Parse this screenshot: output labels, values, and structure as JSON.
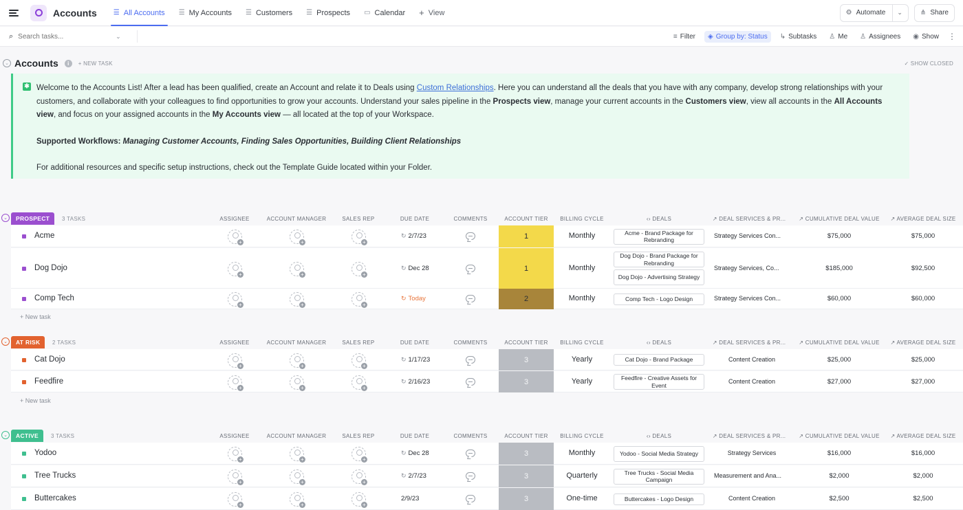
{
  "topbar": {
    "title": "Accounts",
    "tabs": [
      {
        "label": "All Accounts",
        "active": true
      },
      {
        "label": "My Accounts"
      },
      {
        "label": "Customers"
      },
      {
        "label": "Prospects"
      },
      {
        "label": "Calendar"
      },
      {
        "label": "View"
      }
    ],
    "automate": "Automate",
    "share": "Share"
  },
  "filterbar": {
    "search_placeholder": "Search tasks...",
    "filter": "Filter",
    "group_by": "Group by: Status",
    "subtasks": "Subtasks",
    "me": "Me",
    "assignees": "Assignees",
    "show": "Show"
  },
  "list": {
    "title": "Accounts",
    "new_task": "+ NEW TASK",
    "show_closed": "SHOW CLOSED"
  },
  "description": {
    "p1_a": "Welcome to the Accounts List! After a lead has been qualified, create an Account and relate it to Deals using ",
    "p1_link": "Custom Relationships",
    "p1_b": ". Here you can understand all the deals that you have with any company, develop strong relationships with your customers, and collaborate with your colleagues to find opportunities to grow your accounts. Understand your sales pipeline in the ",
    "p1_bold1": "Prospects view",
    "p1_c": ", manage your current accounts in the ",
    "p1_bold2": "Customers view",
    "p1_d": ", view all accounts in the ",
    "p1_bold3": "All Accounts view",
    "p1_e": ", and focus on your assigned accounts in the ",
    "p1_bold4": "My Accounts view",
    "p1_f": " — all located at the top of your Workspace.",
    "workflows_label": "Supported Workflows:",
    "workflows": " Managing Customer Accounts,  Finding Sales Opportunities, Building Client Relationships",
    "p3": "For additional resources and specific setup instructions, check out the Template Guide located within your Folder."
  },
  "columns": {
    "assignee": "ASSIGNEE",
    "account_manager": "ACCOUNT MANAGER",
    "sales_rep": "SALES REP",
    "due_date": "DUE DATE",
    "comments": "COMMENTS",
    "account_tier": "ACCOUNT TIER",
    "billing_cycle": "BILLING CYCLE",
    "deals": "DEALS",
    "deal_services": "DEAL SERVICES & PR...",
    "cumulative": "CUMULATIVE DEAL VALUE",
    "average": "AVERAGE DEAL SIZE"
  },
  "new_task_row": "+ New task",
  "colors": {
    "accent": "#4b6cf0",
    "prospect": "#9b4fcf",
    "at_risk": "#e2622f",
    "active": "#3fbf8f",
    "tier_yellow": "#f3d94a",
    "tier_brown": "#a8853a",
    "tier_gray": "#b9bcc2"
  },
  "groups": [
    {
      "status": "PROSPECT",
      "count": "3 TASKS",
      "tasks": [
        {
          "name": "Acme",
          "due": "2/7/23",
          "tier": "1",
          "billing": "Monthly",
          "deals": [
            "Acme - Brand Package for Rebranding"
          ],
          "services": "Strategy Services Con...",
          "cumulative": "$75,000",
          "average": "$75,000"
        },
        {
          "name": "Dog Dojo",
          "due": "Dec 28",
          "tier": "1",
          "billing": "Monthly",
          "deals": [
            "Dog Dojo - Brand Package for Rebranding",
            "Dog Dojo - Advertising Strategy"
          ],
          "services": "Strategy Services, Co...",
          "cumulative": "$185,000",
          "average": "$92,500"
        },
        {
          "name": "Comp Tech",
          "due": "Today",
          "tier": "2",
          "billing": "Monthly",
          "deals": [
            "Comp Tech - Logo Design"
          ],
          "services": "Strategy Services Con...",
          "cumulative": "$60,000",
          "average": "$60,000"
        }
      ]
    },
    {
      "status": "AT RISK",
      "count": "2 TASKS",
      "tasks": [
        {
          "name": "Cat Dojo",
          "due": "1/17/23",
          "tier": "3",
          "billing": "Yearly",
          "deals": [
            "Cat Dojo - Brand Package"
          ],
          "services": "Content Creation",
          "cumulative": "$25,000",
          "average": "$25,000"
        },
        {
          "name": "Feedfire",
          "due": "2/16/23",
          "tier": "3",
          "billing": "Yearly",
          "deals": [
            "Feedfire - Creative Assets for Event"
          ],
          "services": "Content Creation",
          "cumulative": "$27,000",
          "average": "$27,000"
        }
      ]
    },
    {
      "status": "ACTIVE",
      "count": "3 TASKS",
      "tasks": [
        {
          "name": "Yodoo",
          "due": "Dec 28",
          "tier": "3",
          "billing": "Monthly",
          "deals": [
            "Yodoo - Social Media Strategy"
          ],
          "services": "Strategy Services",
          "cumulative": "$16,000",
          "average": "$16,000"
        },
        {
          "name": "Tree Trucks",
          "due": "2/7/23",
          "tier": "3",
          "billing": "Quarterly",
          "deals": [
            "Tree Trucks - Social Media Campaign"
          ],
          "services": "Measurement and Ana...",
          "cumulative": "$2,000",
          "average": "$2,000"
        },
        {
          "name": "Buttercakes",
          "due": "2/9/23",
          "tier": "3",
          "billing": "One-time",
          "deals": [
            "Buttercakes - Logo Design"
          ],
          "services": "Content Creation",
          "cumulative": "$2,500",
          "average": "$2,500"
        }
      ]
    }
  ]
}
